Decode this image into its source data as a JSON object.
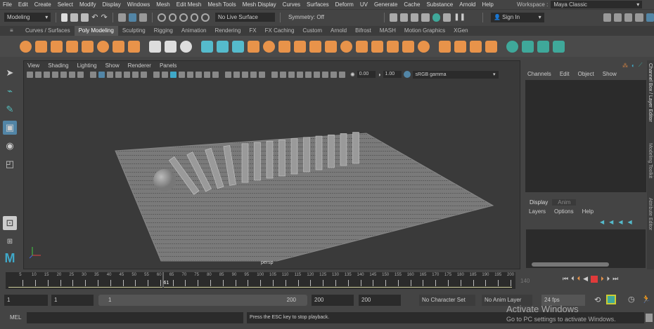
{
  "menubar": {
    "items": [
      "File",
      "Edit",
      "Create",
      "Select",
      "Modify",
      "Display",
      "Windows",
      "Mesh",
      "Edit Mesh",
      "Mesh Tools",
      "Mesh Display",
      "Curves",
      "Surfaces",
      "Deform",
      "UV",
      "Generate",
      "Cache",
      "Substance",
      "Arnold",
      "Help"
    ],
    "workspace_label": "Workspace :",
    "workspace_value": "Maya Classic"
  },
  "status": {
    "mode": "Modeling",
    "live_surface": "No Live Surface",
    "symmetry": "Symmetry: Off",
    "sign_in": "Sign In"
  },
  "shelf": {
    "tabs": [
      "Curves / Surfaces",
      "Poly Modeling",
      "Sculpting",
      "Rigging",
      "Animation",
      "Rendering",
      "FX",
      "FX Caching",
      "Custom",
      "Arnold",
      "Bifrost",
      "MASH",
      "Motion Graphics",
      "XGen"
    ],
    "active": 1,
    "icons": [
      "sphere",
      "cube",
      "cylinder",
      "cone",
      "torus",
      "plane",
      "disc",
      "platonic",
      "super-shape",
      "type",
      "svg",
      "measure",
      "bevel-tool",
      "uv",
      "combine",
      "separate",
      "extract",
      "booleans",
      "smooth",
      "mirror",
      "bridge",
      "extrude",
      "append",
      "fill-hole",
      "multi-cut",
      "offset-loop",
      "insert-loop",
      "target-weld",
      "sculpt",
      "quad-draw",
      "mesh-a",
      "mesh-b",
      "mesh-c",
      "mesh-d"
    ]
  },
  "viewport": {
    "menus": [
      "View",
      "Shading",
      "Lighting",
      "Show",
      "Renderer",
      "Panels"
    ],
    "exposure": "0.00",
    "gamma": "1.00",
    "color_space": "sRGB gamma",
    "camera": "persp"
  },
  "channel_box": {
    "menus": [
      "Channels",
      "Edit",
      "Object",
      "Show"
    ]
  },
  "layer_editor": {
    "tabs": [
      "Display",
      "Anim"
    ],
    "menus": [
      "Layers",
      "Options",
      "Help"
    ]
  },
  "side_tabs": [
    "Channel Box / Layer Editor",
    "Modeling Toolkit",
    "Attribute Editor"
  ],
  "timeline": {
    "start": 5,
    "end": 200,
    "step": 5,
    "current": "61",
    "current_value": 61,
    "end_label": "140"
  },
  "range": {
    "start": "1",
    "playback_start": "1",
    "slider_start": "1",
    "slider_end": "200",
    "playback_end": "200",
    "end": "200",
    "character_set": "No Character Set",
    "anim_layer": "No Anim Layer",
    "fps": "24 fps"
  },
  "command": {
    "label": "MEL",
    "help": "Press the ESC key to stop playback."
  },
  "watermark": {
    "title": "Activate Windows",
    "subtitle": "Go to PC settings to activate Windows."
  },
  "colors": {
    "accent": "#5285a6",
    "shelf_orange": "#e8934a",
    "shelf_teal": "#3fa89a",
    "stop": "#e03a3a"
  }
}
